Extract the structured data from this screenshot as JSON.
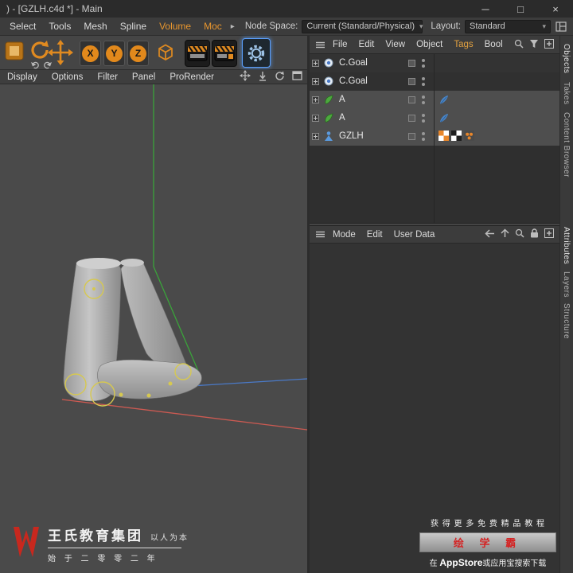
{
  "colors": {
    "accent_orange": "#e2891c",
    "highlight_blue": "#5aa0ff",
    "axis_green": "#3aa33a",
    "axis_red": "#cc5a52",
    "axis_blue": "#4a7ac8",
    "joint_yellow": "#d6c850",
    "brand_red": "#c8281e"
  },
  "icons": {
    "caret_down": "▾",
    "menu_overflow": "▸"
  },
  "titlebar": {
    "title": ") - [GZLH.c4d *] - Main",
    "minimize": "─",
    "maximize": "□",
    "close": "×"
  },
  "menubar": {
    "items": [
      "Select",
      "Tools",
      "Mesh",
      "Spline",
      "Volume",
      "Moc"
    ],
    "node_space_label": "Node Space:",
    "node_space_value": "Current (Standard/Physical)",
    "layout_label": "Layout:",
    "layout_value": "Standard"
  },
  "toolbar": {
    "axis_x": "X",
    "axis_y": "Y",
    "axis_z": "Z"
  },
  "viewport_menu": {
    "items": [
      "Display",
      "Options",
      "Filter",
      "Panel",
      "ProRender"
    ]
  },
  "object_manager": {
    "menu": [
      "File",
      "Edit",
      "View",
      "Object",
      "Tags",
      "Bool"
    ],
    "objects": [
      {
        "name": "C.Goal"
      },
      {
        "name": "C.Goal"
      },
      {
        "name": "A"
      },
      {
        "name": "A"
      },
      {
        "name": "GZLH"
      }
    ]
  },
  "attribute_manager": {
    "menu": [
      "Mode",
      "Edit",
      "User Data"
    ]
  },
  "side_tabs": {
    "top": [
      "Objects",
      "Takes",
      "Content Browser"
    ],
    "bottom": [
      "Attributes",
      "Layers",
      "Structure"
    ]
  },
  "watermarks": {
    "left": {
      "brand": "王氏教育集团",
      "slogan": "以人为本",
      "since": "始 于 二 零 零 二 年"
    },
    "right": {
      "line1": "获 得 更 多 免 费 精 品 教 程",
      "badge": "绘 学 霸",
      "line3_pre": "在 ",
      "line3_bold": "AppStore",
      "line3_post": "或应用宝搜索下载"
    }
  }
}
